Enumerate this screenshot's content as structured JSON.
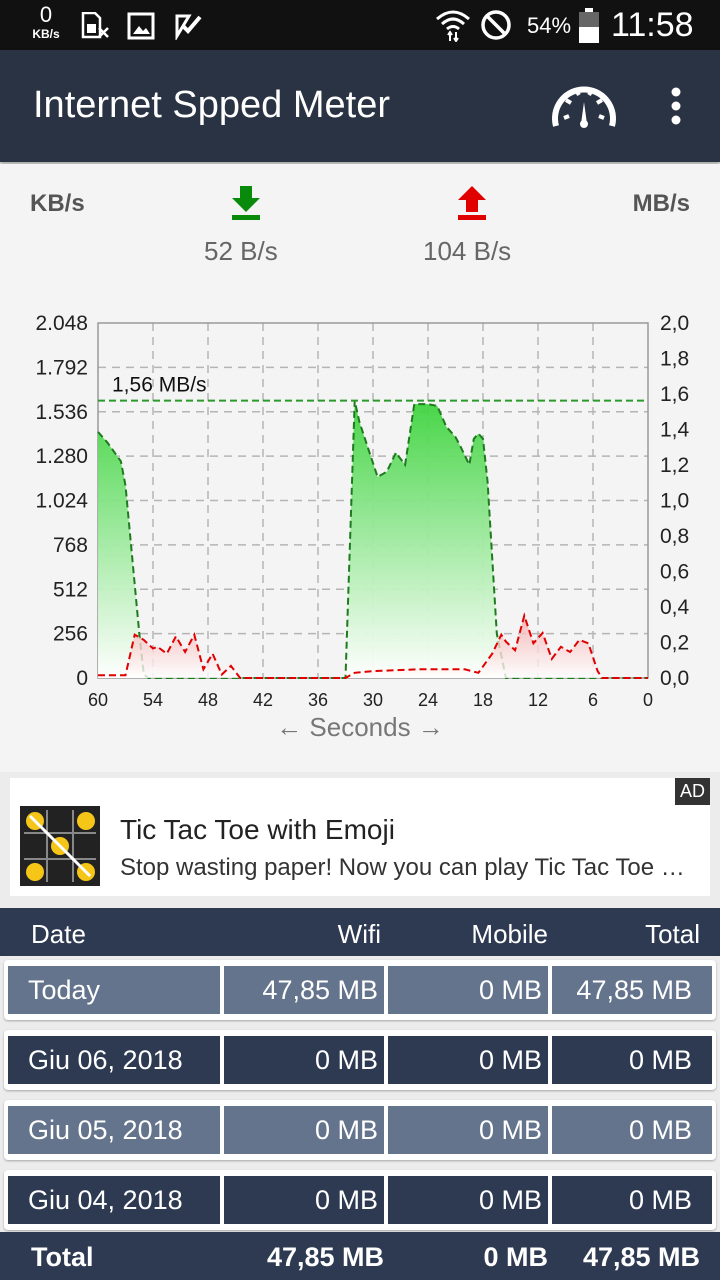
{
  "status_bar": {
    "speed_value": "0",
    "speed_unit": "KB/s",
    "battery": "54%",
    "time": "11:58"
  },
  "app_bar": {
    "title": "Internet Spped Meter",
    "gauge_icon": "speedometer-icon",
    "menu_icon": "more-vert-icon"
  },
  "speed_panel": {
    "left_unit": "KB/s",
    "right_unit": "MB/s",
    "download_rate": "52 B/s",
    "upload_rate": "104 B/s",
    "download_color": "#0a8a0a",
    "upload_color": "#e00000"
  },
  "chart_data": {
    "type": "area",
    "x_label": "← Seconds →",
    "x_ticks": [
      "60",
      "54",
      "48",
      "42",
      "36",
      "30",
      "24",
      "18",
      "12",
      "6",
      "0"
    ],
    "y_left_ticks": [
      "2.048",
      "1.792",
      "1.536",
      "1.280",
      "1.024",
      "768",
      "512",
      "256",
      "0"
    ],
    "y_right_ticks": [
      "2,0",
      "1,8",
      "1,6",
      "1,4",
      "1,2",
      "1,0",
      "0,8",
      "0,6",
      "0,4",
      "0,2",
      "0,0"
    ],
    "xlim": [
      60,
      0
    ],
    "ylim_left": [
      0,
      2048
    ],
    "peak_label": "1,56 MB/s",
    "peak_value": 1600,
    "grid": true,
    "series": [
      {
        "color": "#3fcc3f",
        "points": [
          [
            60,
            1420
          ],
          [
            59,
            1360
          ],
          [
            57.5,
            1250
          ],
          [
            57,
            1110
          ],
          [
            55.5,
            256
          ],
          [
            55,
            20
          ],
          [
            54.5,
            0
          ],
          [
            35,
            0
          ],
          [
            33,
            0
          ],
          [
            32,
            1600
          ],
          [
            31.5,
            1480
          ],
          [
            30.5,
            1320
          ],
          [
            29.5,
            1160
          ],
          [
            28.5,
            1190
          ],
          [
            27.5,
            1300
          ],
          [
            26.5,
            1230
          ],
          [
            25.5,
            1580
          ],
          [
            24,
            1580
          ],
          [
            23,
            1570
          ],
          [
            22,
            1450
          ],
          [
            21,
            1390
          ],
          [
            20.5,
            1340
          ],
          [
            19.5,
            1230
          ],
          [
            19,
            1380
          ],
          [
            18.5,
            1410
          ],
          [
            18,
            1380
          ],
          [
            17.5,
            1130
          ],
          [
            16.5,
            256
          ],
          [
            15.5,
            0
          ],
          [
            0,
            0
          ]
        ]
      },
      {
        "color": "#e00000",
        "points": [
          [
            60,
            16
          ],
          [
            57,
            16
          ],
          [
            56,
            250
          ],
          [
            55,
            220
          ],
          [
            54,
            170
          ],
          [
            53.5,
            180
          ],
          [
            52.5,
            140
          ],
          [
            51.5,
            240
          ],
          [
            50.5,
            150
          ],
          [
            49.5,
            250
          ],
          [
            48.5,
            50
          ],
          [
            47.5,
            140
          ],
          [
            46.5,
            20
          ],
          [
            45.5,
            70
          ],
          [
            44.5,
            0
          ],
          [
            33,
            0
          ],
          [
            32,
            30
          ],
          [
            30,
            40
          ],
          [
            25,
            50
          ],
          [
            20,
            50
          ],
          [
            18.5,
            30
          ],
          [
            17,
            140
          ],
          [
            16,
            250
          ],
          [
            15.5,
            210
          ],
          [
            14.5,
            160
          ],
          [
            13.5,
            360
          ],
          [
            12.5,
            200
          ],
          [
            11.5,
            260
          ],
          [
            10.5,
            110
          ],
          [
            9.5,
            180
          ],
          [
            8.5,
            150
          ],
          [
            7.5,
            220
          ],
          [
            6.5,
            200
          ],
          [
            5.5,
            40
          ],
          [
            5,
            0
          ],
          [
            0,
            0
          ]
        ]
      }
    ]
  },
  "ad": {
    "badge": "AD",
    "title": "Tic Tac Toe with Emoji",
    "text": "Stop wasting paper! Now you can play Tic Tac Toe with Emoji"
  },
  "table": {
    "headers": {
      "date": "Date",
      "wifi": "Wifi",
      "mobile": "Mobile",
      "total": "Total"
    },
    "rows": [
      {
        "date": "Today",
        "wifi": "47,85 MB",
        "mobile": "0 MB",
        "total": "47,85 MB"
      },
      {
        "date": "Giu 06, 2018",
        "wifi": "0 MB",
        "mobile": "0 MB",
        "total": "0 MB"
      },
      {
        "date": "Giu 05, 2018",
        "wifi": "0 MB",
        "mobile": "0 MB",
        "total": "0 MB"
      },
      {
        "date": "Giu 04, 2018",
        "wifi": "0 MB",
        "mobile": "0 MB",
        "total": "0 MB"
      }
    ],
    "footer": {
      "label": "Total",
      "wifi": "47,85 MB",
      "mobile": "0 MB",
      "total": "47,85 MB"
    }
  }
}
